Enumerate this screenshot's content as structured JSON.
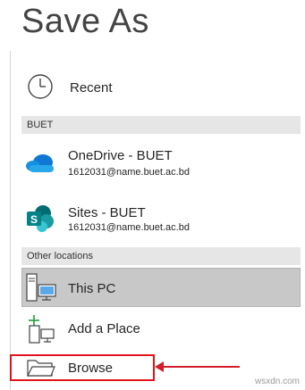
{
  "page": {
    "title": "Save As"
  },
  "recent": {
    "label": "Recent",
    "icon": "clock-icon"
  },
  "sections": [
    {
      "header": "BUET"
    },
    {
      "header": "Other locations"
    }
  ],
  "buet_locations": [
    {
      "label": "OneDrive - BUET",
      "account": "1612031@name.buet.ac.bd",
      "icon": "onedrive-icon"
    },
    {
      "label": "Sites - BUET",
      "account": "1612031@name.buet.ac.bd",
      "icon": "sharepoint-icon"
    }
  ],
  "other_locations": [
    {
      "label": "This PC",
      "icon": "computer-icon",
      "selected": true
    },
    {
      "label": "Add a Place",
      "icon": "add-place-icon",
      "selected": false
    },
    {
      "label": "Browse",
      "icon": "folder-icon",
      "selected": false
    }
  ],
  "colors": {
    "annotation_red": "#d21e28",
    "selected_bg": "#c8c8c8",
    "section_bg": "#e6e6e6",
    "onedrive_blue": "#0f78d4",
    "sharepoint_teal": "#038387"
  },
  "watermark": "wsxdn.com"
}
